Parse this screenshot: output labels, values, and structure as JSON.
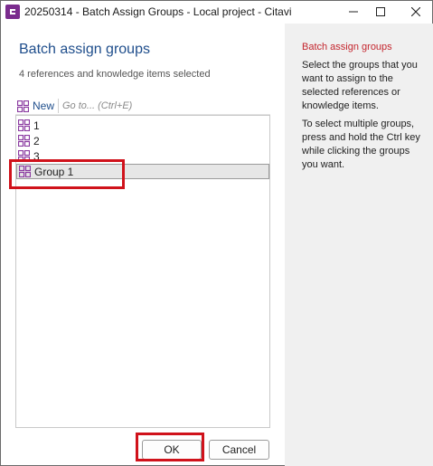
{
  "window": {
    "title": "20250314 - Batch Assign Groups - Local project - Citavi",
    "minimize_glyph": "—",
    "maximize_glyph": "☐",
    "close_glyph": "✕"
  },
  "dialog": {
    "title": "Batch assign groups",
    "selection_info": "4 references and knowledge items selected"
  },
  "toolbar": {
    "new_label": "New",
    "goto_placeholder": "Go to... (Ctrl+E)",
    "goto_value": ""
  },
  "groups": [
    {
      "label": "1",
      "selected": false
    },
    {
      "label": "2",
      "selected": false
    },
    {
      "label": "3",
      "selected": false
    },
    {
      "label": "Group 1",
      "selected": true
    }
  ],
  "buttons": {
    "ok_label": "OK",
    "cancel_label": "Cancel"
  },
  "help": {
    "title": "Batch assign groups",
    "paragraph1": "Select the groups that you want to assign to the selected references or knowledge items.",
    "paragraph2": "To select multiple groups, press and hold the Ctrl key while clicking the groups you want."
  },
  "colors": {
    "accent_blue": "#1f4e8c",
    "help_title_red": "#c4262e",
    "highlight_red": "#d0121b",
    "group_icon_purple": "#8a3aa0",
    "app_icon_purple": "#7b2c8e"
  },
  "icons": {
    "app": "citavi-logo-icon",
    "new": "new-group-icon",
    "group": "group-icon"
  }
}
